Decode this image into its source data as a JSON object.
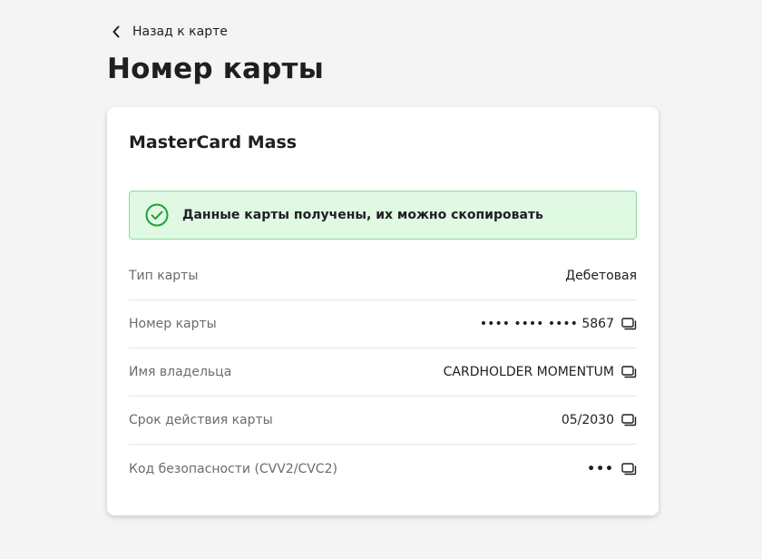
{
  "nav": {
    "back_label": "Назад к карте"
  },
  "page": {
    "title": "Номер карты"
  },
  "card": {
    "name": "MasterCard Mass",
    "alert_text": "Данные карты получены, их можно скопировать",
    "rows": [
      {
        "label": "Тип карты",
        "value": "Дебетовая",
        "copyable": false
      },
      {
        "label": "Номер карты",
        "value": "•••• •••• •••• 5867",
        "copyable": true
      },
      {
        "label": "Имя владельца",
        "value": "CARDHOLDER MOMENTUM",
        "copyable": true
      },
      {
        "label": "Срок действия карты",
        "value": "05/2030",
        "copyable": true
      },
      {
        "label": "Код безопасности (CVV2/CVC2)",
        "value": "•••",
        "copyable": true
      }
    ]
  },
  "icons": {
    "back": "chevron-left-icon",
    "success": "check-circle-icon",
    "copy": "copy-icon"
  },
  "colors": {
    "success_green": "#21a038",
    "alert_bg": "#dff9e3",
    "alert_border": "#8fd99d",
    "page_bg": "#f4f4f4"
  }
}
